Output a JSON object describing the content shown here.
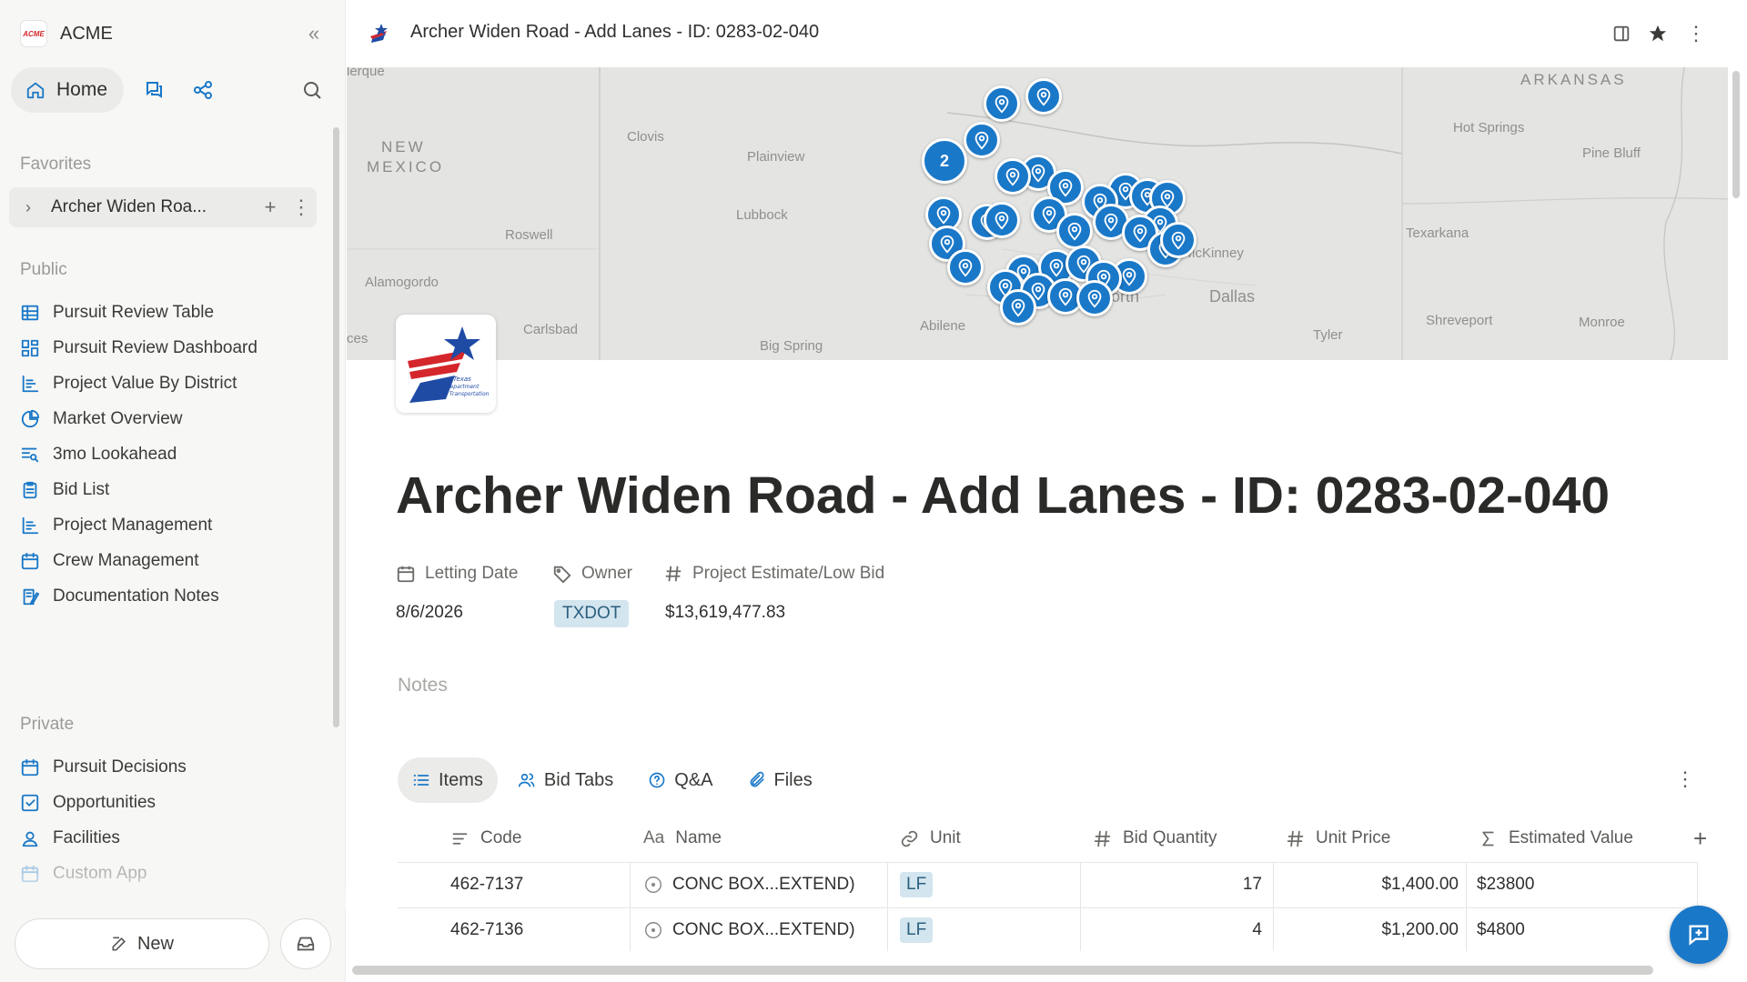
{
  "app": {
    "name": "ACME",
    "logo_text": "ACME"
  },
  "nav": {
    "home_label": "Home"
  },
  "sidebar": {
    "favorites_label": "Favorites",
    "favorite_item": "Archer Widen Roa...",
    "public_label": "Public",
    "public_items": [
      {
        "label": "Pursuit Review Table",
        "icon": "table-icon"
      },
      {
        "label": "Pursuit Review Dashboard",
        "icon": "dashboard-icon"
      },
      {
        "label": "Project Value By District",
        "icon": "bar-chart-icon"
      },
      {
        "label": "Market Overview",
        "icon": "pie-chart-icon"
      },
      {
        "label": "3mo Lookahead",
        "icon": "list-search-icon"
      },
      {
        "label": "Bid List",
        "icon": "clipboard-icon"
      },
      {
        "label": "Project Management",
        "icon": "bar-chart-icon"
      },
      {
        "label": "Crew Management",
        "icon": "calendar-icon"
      },
      {
        "label": "Documentation Notes",
        "icon": "notes-icon"
      }
    ],
    "private_label": "Private",
    "private_items": [
      {
        "label": "Pursuit Decisions",
        "icon": "calendar-icon"
      },
      {
        "label": "Opportunities",
        "icon": "checkbox-icon"
      },
      {
        "label": "Facilities",
        "icon": "person-pin-icon"
      },
      {
        "label": "Custom App",
        "icon": "calendar-icon"
      }
    ],
    "new_label": "New"
  },
  "page": {
    "breadcrumb_title": "Archer Widen Road - Add Lanes - ID: 0283-02-040",
    "title": "Archer Widen Road - Add Lanes - ID: 0283-02-040",
    "properties": {
      "letting_date_label": "Letting Date",
      "letting_date_value": "8/6/2026",
      "owner_label": "Owner",
      "owner_value": "TXDOT",
      "estimate_label": "Project Estimate/Low Bid",
      "estimate_value": "$13,619,477.83"
    },
    "notes_placeholder": "Notes",
    "logo_text": "Texas Department of Transportation"
  },
  "map": {
    "cluster_count": "2",
    "labels": [
      "ARKANSAS",
      "NEW",
      "MEXICO",
      "lerque",
      "Clovis",
      "Plainview",
      "Lubbock",
      "Roswell",
      "Alamogordo",
      "Carlsbad",
      "Big Spring",
      "Abilene",
      "Dallas",
      "McKinney",
      "Texarkana",
      "Tyler",
      "Shreveport",
      "Monroe",
      "Hot Springs",
      "Pine Bluff",
      "ces",
      "orth"
    ]
  },
  "tabs": [
    {
      "label": "Items",
      "icon": "list-icon",
      "active": true
    },
    {
      "label": "Bid Tabs",
      "icon": "people-icon"
    },
    {
      "label": "Q&A",
      "icon": "question-icon"
    },
    {
      "label": "Files",
      "icon": "paperclip-icon"
    }
  ],
  "table": {
    "columns": [
      {
        "label": "Code",
        "icon": "text-lines-icon"
      },
      {
        "label": "Name",
        "icon": "text-aa-icon"
      },
      {
        "label": "Unit",
        "icon": "link-icon"
      },
      {
        "label": "Bid Quantity",
        "icon": "hash-icon"
      },
      {
        "label": "Unit Price",
        "icon": "hash-icon"
      },
      {
        "label": "Estimated Value",
        "icon": "sigma-icon"
      }
    ],
    "rows": [
      {
        "code": "462-7137",
        "name": "CONC BOX...EXTEND)",
        "unit": "LF",
        "qty": "17",
        "price": "$1,400.00",
        "value": "$23800"
      },
      {
        "code": "462-7136",
        "name": "CONC BOX...EXTEND)",
        "unit": "LF",
        "qty": "4",
        "price": "$1,200.00",
        "value": "$4800"
      }
    ]
  },
  "colors": {
    "accent": "#1a78c8",
    "tag_bg": "#d3e5ef",
    "tag_text": "#2b5f7e",
    "sidebar_bg": "#f7f7f5"
  }
}
